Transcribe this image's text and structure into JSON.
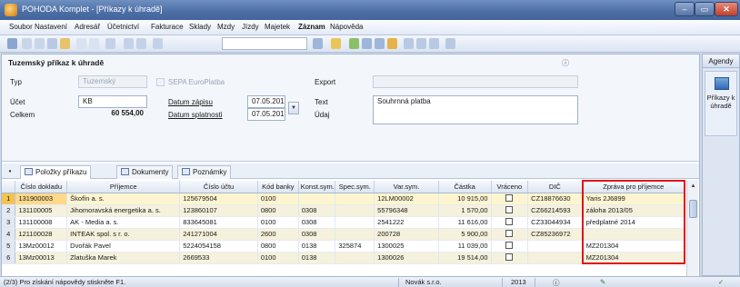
{
  "window": {
    "title": "POHODA Komplet - [Příkazy k úhradě]",
    "minimize": "–",
    "maximize": "▭",
    "close": "✕"
  },
  "menu": [
    "Soubor",
    "Nastavení",
    "Adresář",
    "Účetnictví",
    "Fakturace",
    "Sklady",
    "Mzdy",
    "Jízdy",
    "Majetek",
    "Záznam",
    "Nápověda"
  ],
  "form": {
    "title": "Tuzemský příkaz k úhradě",
    "typ_label": "Typ",
    "typ_value": "Tuzemský",
    "sepa_label": "SEPA EuroPlatba",
    "export_label": "Export",
    "ucet_label": "Účet",
    "ucet_value": "KB",
    "celkem_label": "Celkem",
    "celkem_value": "60 554,00",
    "datum_zapisu_label": "Datum zápisu",
    "datum_zapisu_value": "07.05.2013",
    "datum_splatnosti_label": "Datum splatnosti",
    "datum_splatnosti_value": "07.05.2013",
    "text_label": "Text",
    "text_value": "Souhrnná platba",
    "udaj_label": "Údaj"
  },
  "tabs": [
    "Položky příkazu",
    "Dokumenty",
    "Poznámky"
  ],
  "table": {
    "columns": [
      "",
      "Číslo dokladu",
      "Příjemce",
      "Číslo účtu",
      "Kód banky",
      "Konst.sym.",
      "Spec.sym.",
      "Var.sym.",
      "Částka",
      "Vráceno",
      "DIČ",
      "Zpráva pro příjemce"
    ],
    "rows": [
      [
        "1",
        "131900003",
        "Škofín a. s.",
        "125679504",
        "0100",
        "",
        "",
        "12LM00002",
        "10 915,00",
        "",
        "CZ18876630",
        "Yaris 2J6899"
      ],
      [
        "2",
        "131100005",
        "Jihomoravská energetika a. s.",
        "123860107",
        "0800",
        "0308",
        "",
        "55796348",
        "1 570,00",
        "",
        "CZ66214593",
        "záloha 2013/05"
      ],
      [
        "3",
        "131100008",
        "AK - Media a. s.",
        "833645081",
        "0100",
        "0308",
        "",
        "2541222",
        "11 616,00",
        "",
        "CZ33044934",
        "předplatné 2014"
      ],
      [
        "4",
        "121100028",
        "INTEAK spol. s r. o.",
        "241271004",
        "2600",
        "0308",
        "",
        "200728",
        "5 900,00",
        "",
        "CZ85236972",
        ""
      ],
      [
        "5",
        "13Mz00012",
        "Dvořák Pavel",
        "5224054158",
        "0800",
        "0138",
        "325874",
        "1300025",
        "11 039,00",
        "",
        "",
        "MZ201304"
      ],
      [
        "6",
        "13Mz00013",
        "Zlatuška Marek",
        "2669533",
        "0100",
        "0138",
        "",
        "1300026",
        "19 514,00",
        "",
        "",
        "MZ201304"
      ]
    ]
  },
  "agenda": {
    "title": "Agendy",
    "item": "Příkazy k úhradě"
  },
  "status": {
    "hint": "(2/3) Pro získání nápovědy stiskněte F1.",
    "company": "Novák s.r.o.",
    "year": "2013"
  },
  "colors": {
    "highlight": "#e0141a",
    "selected_row": "#f6c34f"
  }
}
